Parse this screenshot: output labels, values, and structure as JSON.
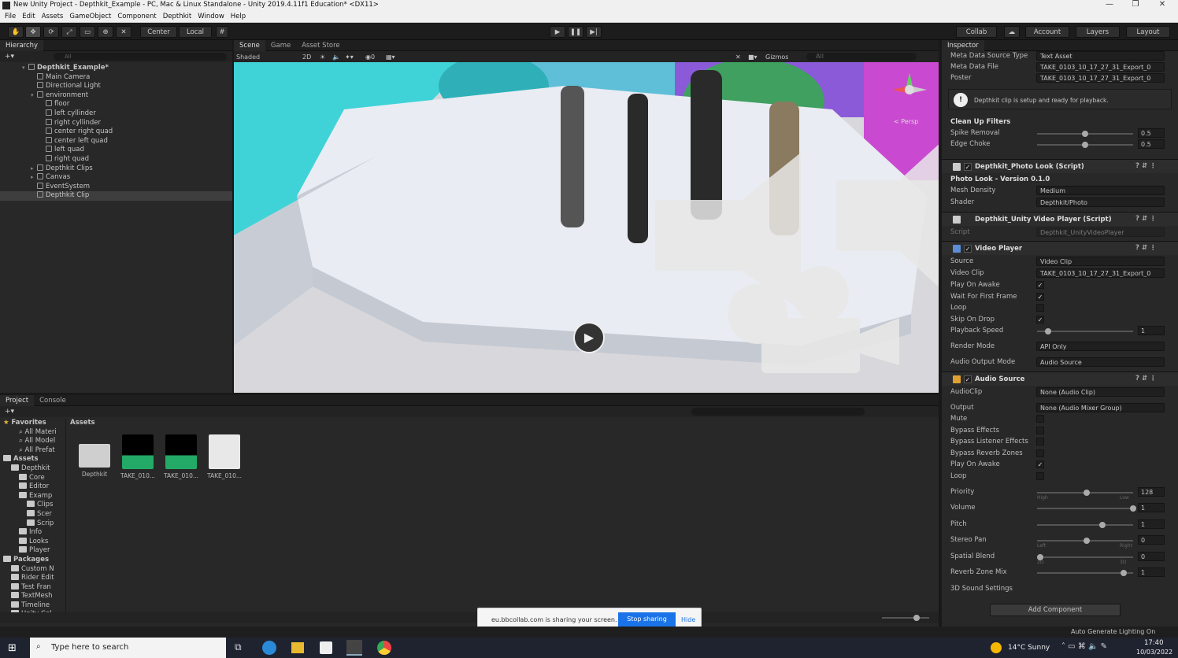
{
  "titlebar": {
    "title": "New Unity Project - Depthkit_Example - PC, Mac & Linux Standalone - Unity 2019.4.11f1 Education* <DX11>"
  },
  "menu": [
    "File",
    "Edit",
    "Assets",
    "GameObject",
    "Component",
    "Depthkit",
    "Window",
    "Help"
  ],
  "toolbar": {
    "center": "Center",
    "local": "Local",
    "collab": "Collab",
    "account": "Account",
    "layers": "Layers",
    "layout": "Layout"
  },
  "hierarchy": {
    "title": "Hierarchy",
    "search_placeholder": "All",
    "items": [
      {
        "label": "Depthkit_Example*",
        "indent": 0,
        "kind": "scene"
      },
      {
        "label": "Main Camera",
        "indent": 1
      },
      {
        "label": "Directional Light",
        "indent": 1
      },
      {
        "label": "environment",
        "indent": 1,
        "expand": true
      },
      {
        "label": "floor",
        "indent": 2
      },
      {
        "label": "left cyllinder",
        "indent": 2
      },
      {
        "label": "right cyllinder",
        "indent": 2
      },
      {
        "label": "center right quad",
        "indent": 2
      },
      {
        "label": "center left quad",
        "indent": 2
      },
      {
        "label": "left quad",
        "indent": 2
      },
      {
        "label": "right quad",
        "indent": 2
      },
      {
        "label": "Depthkit Clips",
        "indent": 1,
        "expand": true
      },
      {
        "label": "Canvas",
        "indent": 1,
        "expand": true
      },
      {
        "label": "EventSystem",
        "indent": 1
      },
      {
        "label": "Depthkit Clip",
        "indent": 1,
        "selected": true
      }
    ]
  },
  "scene": {
    "tabs": [
      "Scene",
      "Game",
      "Asset Store"
    ],
    "shading": "Shaded",
    "mode2d": "2D",
    "gizmos": "Gizmos",
    "search_placeholder": "All",
    "persp": "< Persp"
  },
  "inspector": {
    "title": "Inspector",
    "meta_rows": [
      {
        "label": "Meta Data Source Type",
        "value": "Text Asset"
      },
      {
        "label": "Meta Data File",
        "value": "TAKE_0103_10_17_27_31_Export_0"
      },
      {
        "label": "Poster",
        "value": "TAKE_0103_10_17_27_31_Export_0"
      }
    ],
    "info_message": "Depthkit clip is setup and ready for playback.",
    "cleanup_title": "Clean Up Filters",
    "spike_removal": {
      "label": "Spike Removal",
      "value": "0.5",
      "fraction": 0.5
    },
    "edge_choke": {
      "label": "Edge Choke",
      "value": "0.5",
      "fraction": 0.5
    },
    "photo_look": {
      "header": "Depthkit_Photo Look (Script)",
      "version": "Photo Look - Version 0.1.0",
      "mesh_density_label": "Mesh Density",
      "mesh_density": "Medium",
      "shader_label": "Shader",
      "shader": "Depthkit/Photo"
    },
    "unity_video_player": {
      "header": "Depthkit_Unity Video Player (Script)",
      "script_label": "Script",
      "script": "Depthkit_UnityVideoPlayer"
    },
    "video_player": {
      "header": "Video Player",
      "source_label": "Source",
      "source": "Video Clip",
      "video_clip_label": "Video Clip",
      "video_clip": "TAKE_0103_10_17_27_31_Export_0",
      "checks": [
        {
          "label": "Play On Awake",
          "checked": true
        },
        {
          "label": "Wait For First Frame",
          "checked": true
        },
        {
          "label": "Loop",
          "checked": false
        },
        {
          "label": "Skip On Drop",
          "checked": true
        }
      ],
      "playback_speed_label": "Playback Speed",
      "playback_speed": "1",
      "playback_fraction": 0.1,
      "render_mode_label": "Render Mode",
      "render_mode": "API Only",
      "audio_output_label": "Audio Output Mode",
      "audio_output": "Audio Source"
    },
    "audio_source": {
      "header": "Audio Source",
      "audioclip_label": "AudioClip",
      "audioclip": "None (Audio Clip)",
      "output_label": "Output",
      "output": "None (Audio Mixer Group)",
      "checks": [
        {
          "label": "Mute",
          "checked": false
        },
        {
          "label": "Bypass Effects",
          "checked": false
        },
        {
          "label": "Bypass Listener Effects",
          "checked": false
        },
        {
          "label": "Bypass Reverb Zones",
          "checked": false
        },
        {
          "label": "Play On Awake",
          "checked": true
        },
        {
          "label": "Loop",
          "checked": false
        }
      ],
      "sliders": [
        {
          "label": "Priority",
          "value": "128",
          "fraction": 0.5,
          "low": "High",
          "high": "Low"
        },
        {
          "label": "Volume",
          "value": "1",
          "fraction": 1.0
        },
        {
          "label": "Pitch",
          "value": "1",
          "fraction": 0.67
        },
        {
          "label": "Stereo Pan",
          "value": "0",
          "fraction": 0.5,
          "low": "Left",
          "high": "Right"
        },
        {
          "label": "Spatial Blend",
          "value": "0",
          "fraction": 0.0,
          "low": "2D",
          "high": "3D"
        },
        {
          "label": "Reverb Zone Mix",
          "value": "1",
          "fraction": 0.9
        }
      ],
      "sound_settings": "3D Sound Settings"
    },
    "add_component": "Add Component"
  },
  "project": {
    "tabs": [
      "Project",
      "Console"
    ],
    "favorites_label": "Favorites",
    "favorites": [
      "All Materi",
      "All Model",
      "All Prefat"
    ],
    "assets_label": "Assets",
    "asset_tree": [
      {
        "label": "Depthkit",
        "indent": 1
      },
      {
        "label": "Core",
        "indent": 2
      },
      {
        "label": "Editor",
        "indent": 2
      },
      {
        "label": "Examp",
        "indent": 2
      },
      {
        "label": "Clips",
        "indent": 3
      },
      {
        "label": "Scer",
        "indent": 3
      },
      {
        "label": "Scrip",
        "indent": 3
      },
      {
        "label": "Info",
        "indent": 2
      },
      {
        "label": "Looks",
        "indent": 2
      },
      {
        "label": "Player",
        "indent": 2
      }
    ],
    "packages_label": "Packages",
    "packages": [
      "Custom N",
      "Rider Edit",
      "Test Fran",
      "TextMesh",
      "Timeline",
      "Unity Col"
    ],
    "breadcrumb": "Assets",
    "assets": [
      {
        "label": "Depthkit",
        "kind": "folder"
      },
      {
        "label": "TAKE_010...",
        "kind": "clip"
      },
      {
        "label": "TAKE_010...",
        "kind": "clip"
      },
      {
        "label": "TAKE_010...",
        "kind": "text"
      }
    ]
  },
  "screen_share": {
    "text": "eu.bbcollab.com is sharing your screen.",
    "stop": "Stop sharing",
    "hide": "Hide"
  },
  "status": {
    "right": "Auto Generate Lighting On"
  },
  "taskbar": {
    "search_placeholder": "Type here to search",
    "weather": "14°C Sunny",
    "time": "17:40",
    "date": "10/03/2022"
  }
}
